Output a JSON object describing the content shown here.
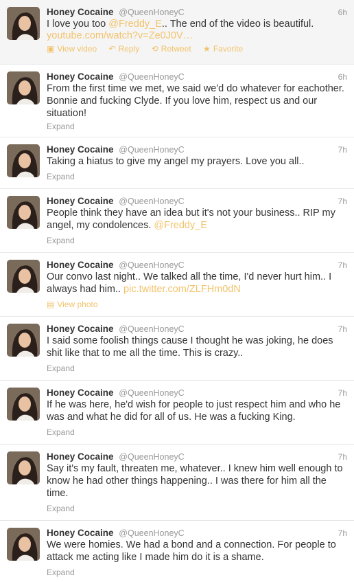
{
  "tweets": [
    {
      "name": "Honey Cocaine",
      "handle": "@QueenHoneyC",
      "time": "6h",
      "text_parts": [
        "I love you too ",
        "@Freddy_E",
        ".. The end of the video is beautiful."
      ],
      "link": "youtube.com/watch?v=Ze0J0V…",
      "actions": [
        "View video",
        "Reply",
        "Retweet",
        "Favorite"
      ]
    },
    {
      "name": "Honey Cocaine",
      "handle": "@QueenHoneyC",
      "time": "6h",
      "text": "From the first time we met, we said we'd do whatever for eachother. Bonnie and fucking Clyde. If you love him, respect us and our situation!",
      "footer": "Expand"
    },
    {
      "name": "Honey Cocaine",
      "handle": "@QueenHoneyC",
      "time": "7h",
      "text": "Taking a hiatus to give my angel my prayers. Love you all..",
      "footer": "Expand"
    },
    {
      "name": "Honey Cocaine",
      "handle": "@QueenHoneyC",
      "time": "7h",
      "text_parts": [
        "People think they have an idea but it's not your business.. RIP my angel, my condolences. ",
        "@Freddy_E",
        ""
      ],
      "footer": "Expand"
    },
    {
      "name": "Honey Cocaine",
      "handle": "@QueenHoneyC",
      "time": "7h",
      "text_parts": [
        "Our convo last night.. We talked all the time, I'd never hurt him.. I always had him.. ",
        "pic.twitter.com/ZLFHm0dN",
        ""
      ],
      "footer": "View photo"
    },
    {
      "name": "Honey Cocaine",
      "handle": "@QueenHoneyC",
      "time": "7h",
      "text": "I said some foolish things cause I thought he was joking, he does shit like that to me all the time. This is crazy..",
      "footer": "Expand"
    },
    {
      "name": "Honey Cocaine",
      "handle": "@QueenHoneyC",
      "time": "7h",
      "text": "If he was here, he'd wish for people to just respect him and who he was and what he did for all of us. He was a fucking King.",
      "footer": "Expand"
    },
    {
      "name": "Honey Cocaine",
      "handle": "@QueenHoneyC",
      "time": "7h",
      "text": "Say it's my fault, threaten me, whatever.. I knew him well enough to know he had other things happening.. I was there for him all the time.",
      "footer": "Expand"
    },
    {
      "name": "Honey Cocaine",
      "handle": "@QueenHoneyC",
      "time": "7h",
      "text": "We were homies. We had a bond and a connection. For people to attack me acting like I made him do it is a shame.",
      "footer": "Expand"
    }
  ],
  "colors": {
    "link": "#f2c36b",
    "muted": "#999999",
    "text": "#333333",
    "highlight_bg": "#f5f5f5"
  },
  "icons": [
    "avatar",
    "video-icon",
    "reply-icon",
    "retweet-icon",
    "favorite-icon",
    "photo-icon"
  ]
}
